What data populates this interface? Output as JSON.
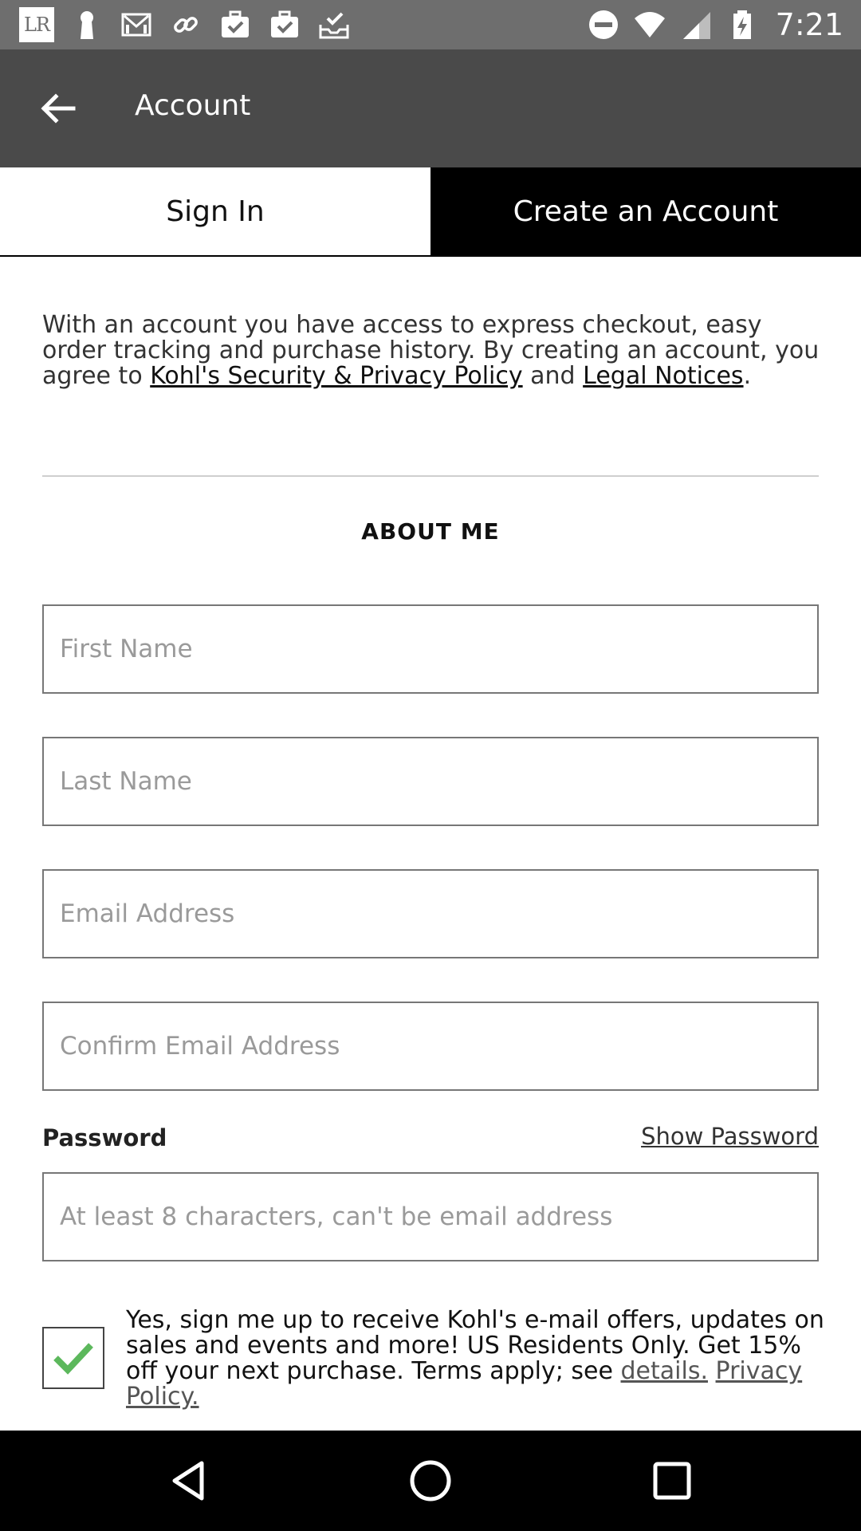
{
  "status_bar": {
    "left_icons": [
      "lr-app-icon",
      "keyhole-icon",
      "gmail-icon",
      "link-icon",
      "briefcase-check-icon",
      "briefcase-check-icon",
      "inbox-check-icon"
    ],
    "lr_text": "LR",
    "right_icons": [
      "do-not-disturb-icon",
      "wifi-icon",
      "signal-icon",
      "battery-charging-icon"
    ],
    "time": "7:21"
  },
  "app_bar": {
    "title": "Account",
    "back_icon": "arrow-back-icon"
  },
  "tabs": [
    {
      "label": "Sign In",
      "active": false
    },
    {
      "label": "Create an Account",
      "active": true
    }
  ],
  "intro": {
    "text_1": "With an account you have access to express checkout, easy order tracking and purchase history. By creating an account, you agree to ",
    "link_privacy": "Kohl's Security & Privacy Policy",
    "text_2": " and ",
    "link_legal": "Legal Notices",
    "text_3": "."
  },
  "section_title": "ABOUT ME",
  "form": {
    "first_name": {
      "placeholder": "First Name",
      "value": ""
    },
    "last_name": {
      "placeholder": "Last Name",
      "value": ""
    },
    "email": {
      "placeholder": "Email Address",
      "value": ""
    },
    "confirm_email": {
      "placeholder": "Confirm Email Address",
      "value": ""
    },
    "password_label": "Password",
    "show_password": "Show Password",
    "password": {
      "placeholder": "At least 8 characters, can't be email address",
      "value": ""
    }
  },
  "optin": {
    "checked": true,
    "check_color": "#5cb85c",
    "text": "Yes, sign me up to receive Kohl's e-mail offers, updates on sales and events and more! US Residents Only. Get 15% off your next purchase. Terms apply; see ",
    "link_details": "details.",
    "link_privacy": "Privacy Policy."
  },
  "nav_bar": {
    "buttons": [
      "back-triangle-icon",
      "home-circle-icon",
      "recents-square-icon"
    ]
  },
  "colors": {
    "status_bar": "#6e6e6e",
    "app_bar": "#4a4a4a",
    "tab_inactive": "#000000",
    "nav_bar": "#000000"
  }
}
